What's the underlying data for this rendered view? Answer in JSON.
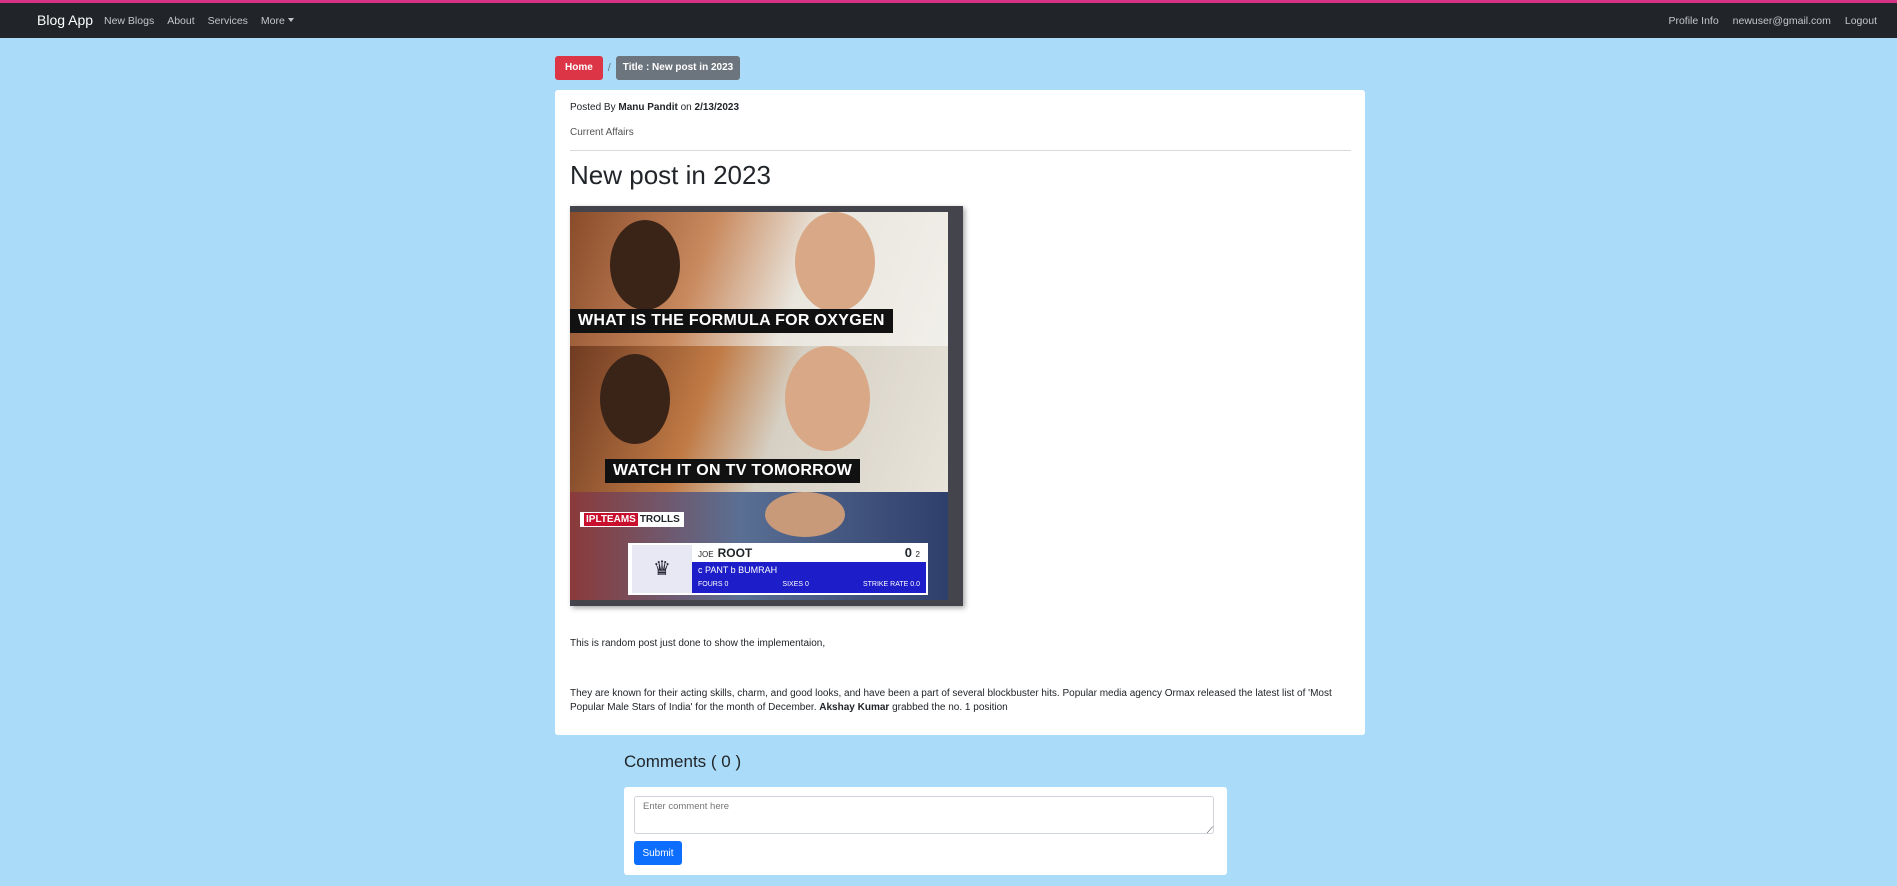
{
  "navbar": {
    "brand": "Blog App",
    "left_items": [
      "New Blogs",
      "About",
      "Services",
      "More"
    ],
    "right_items": [
      "Profile Info",
      "newuser@gmail.com",
      "Logout"
    ]
  },
  "breadcrumb": {
    "home": "Home",
    "separator": "/",
    "current": "Title : New post in 2023"
  },
  "post": {
    "posted_by_label": "Posted By",
    "author": "Manu Pandit",
    "on_label": "on",
    "date": "2/13/2023",
    "category": "Current Affairs",
    "title": "New post in 2023",
    "image": {
      "caption_top": "WHAT IS THE FORMULA FOR OXYGEN",
      "caption_middle": "WATCH IT ON TV TOMORROW",
      "watermark_red": "IPLTEAMS",
      "watermark_black": "TROLLS",
      "score_first": "JOE",
      "score_last": "ROOT",
      "score_runs": "0",
      "score_balls": "2",
      "dismissal": "c  PANT   b  BUMRAH",
      "fours": "FOURS 0",
      "sixes": "SIXES 0",
      "strike_rate": "STRIKE RATE 0.0"
    },
    "paragraph1": "This is random post just done to show the implementaion,",
    "paragraph2_before": "They are known for their acting skills, charm, and good looks, and have been a part of several blockbuster hits. Popular media agency Ormax released the latest list of 'Most Popular Male Stars of India' for the month of December. ",
    "paragraph2_bold": "Akshay Kumar",
    "paragraph2_after": " grabbed the no. 1 position"
  },
  "comments": {
    "heading": "Comments ( 0 )",
    "placeholder": "Enter comment here",
    "submit_label": "Submit"
  },
  "colors": {
    "page_background": "#aadcfa",
    "navbar": "#212529",
    "home_button": "#dc3545",
    "breadcrumb_current": "#6c757d",
    "submit_button": "#0d6efd",
    "top_accent": "#d63384"
  }
}
